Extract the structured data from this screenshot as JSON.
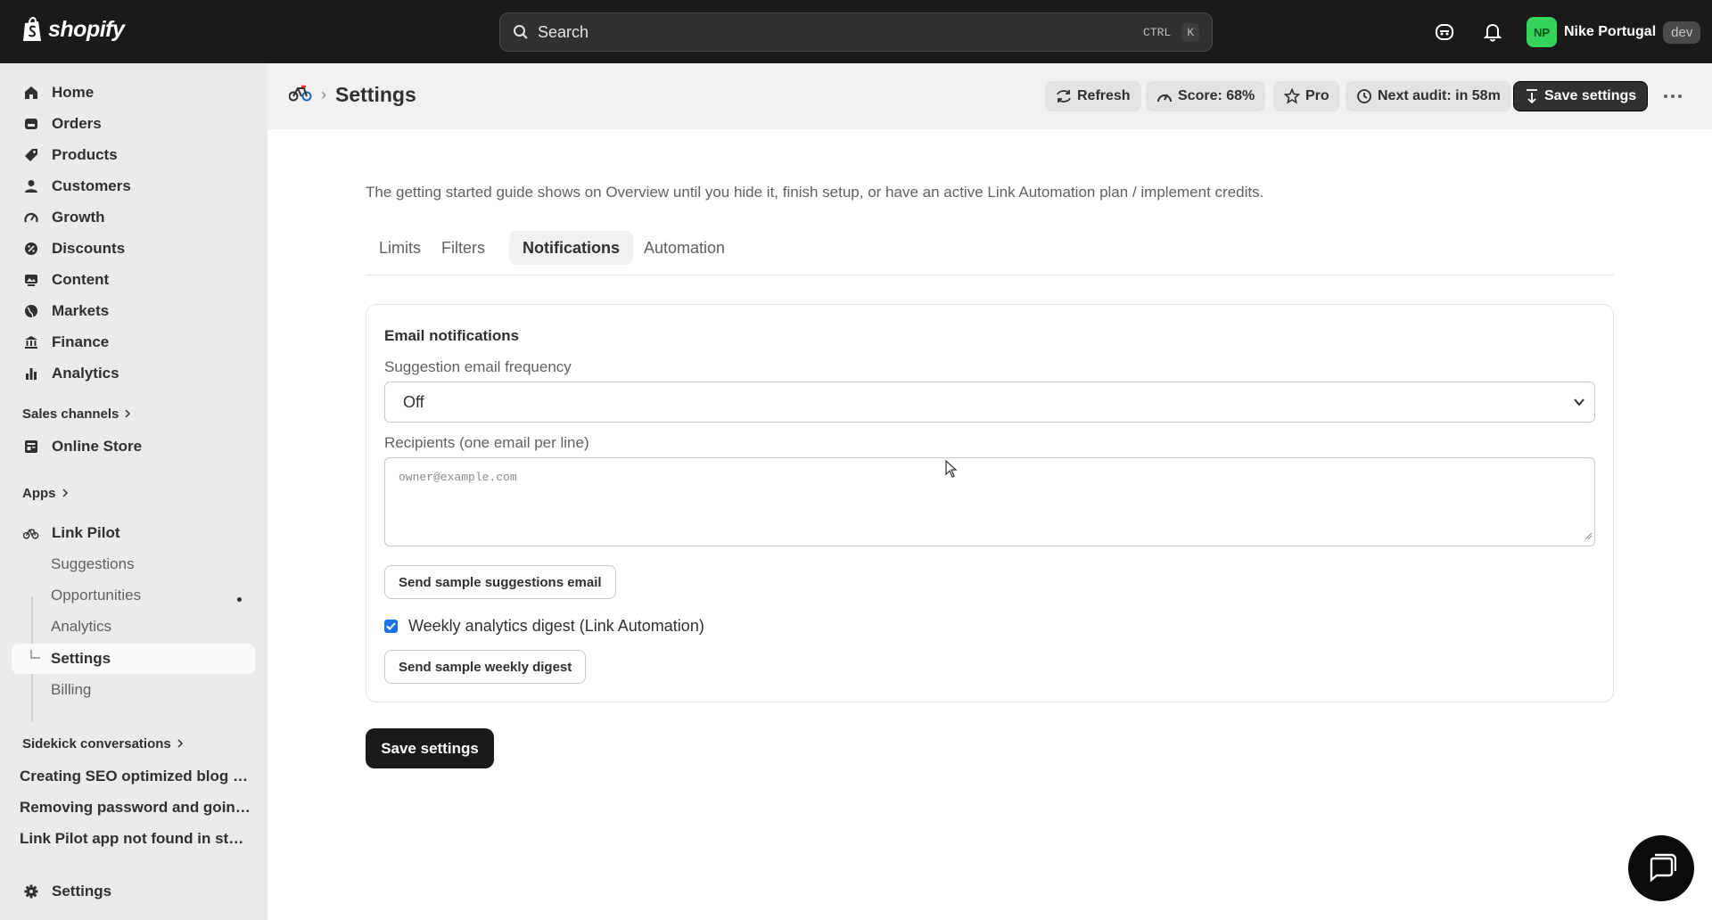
{
  "topbar": {
    "logo_text": "shopify",
    "search_placeholder": "Search",
    "shortcut_ctrl": "CTRL",
    "shortcut_k": "K",
    "user_initials": "NP",
    "user_name": "Nike Portugal",
    "env_badge": "dev"
  },
  "sidebar": {
    "items": [
      {
        "label": "Home",
        "icon": "home-icon"
      },
      {
        "label": "Orders",
        "icon": "orders-icon"
      },
      {
        "label": "Products",
        "icon": "tag-icon"
      },
      {
        "label": "Customers",
        "icon": "person-icon"
      },
      {
        "label": "Growth",
        "icon": "gauge-icon"
      },
      {
        "label": "Discounts",
        "icon": "discount-icon"
      },
      {
        "label": "Content",
        "icon": "content-icon"
      },
      {
        "label": "Markets",
        "icon": "globe-icon"
      },
      {
        "label": "Finance",
        "icon": "bank-icon"
      },
      {
        "label": "Analytics",
        "icon": "bar-chart-icon"
      }
    ],
    "sales_channels_title": "Sales channels",
    "online_store": "Online Store",
    "apps_title": "Apps",
    "app_name": "Link Pilot",
    "app_subitems": [
      "Suggestions",
      "Opportunities",
      "Analytics",
      "Settings",
      "Billing"
    ],
    "sidekick_title": "Sidekick conversations",
    "conversations": [
      "Creating SEO optimized blog p...",
      "Removing password and going...",
      "Link Pilot app not found in store"
    ],
    "settings_label": "Settings"
  },
  "header": {
    "title": "Settings",
    "refresh": "Refresh",
    "score": "Score: 68%",
    "plan": "Pro",
    "next_audit": "Next audit: in 58m",
    "save": "Save settings"
  },
  "main": {
    "intro": "The getting started guide shows on Overview until you hide it, finish setup, or have an active Link Automation plan / implement credits.",
    "tabs": [
      "Limits",
      "Filters",
      "Notifications",
      "Automation"
    ],
    "active_tab": "Notifications",
    "card": {
      "title": "Email notifications",
      "frequency_label": "Suggestion email frequency",
      "frequency_value": "Off",
      "recipients_label": "Recipients (one email per line)",
      "recipients_placeholder": "owner@example.com",
      "sample_suggestions_button": "Send sample suggestions email",
      "weekly_digest_label": "Weekly analytics digest (Link Automation)",
      "weekly_digest_checked": true,
      "sample_weekly_button": "Send sample weekly digest"
    },
    "save_button": "Save settings"
  },
  "colors": {
    "topbar_bg": "#1a1a1a",
    "sidebar_bg": "#ebebeb",
    "accent_dark": "#303030",
    "avatar_green": "#36d35b",
    "checkbox_blue": "#1a73e8"
  }
}
